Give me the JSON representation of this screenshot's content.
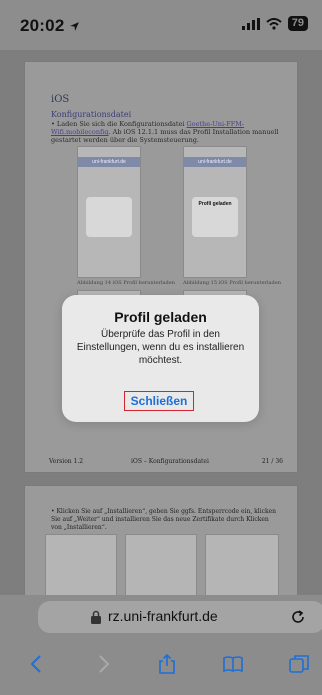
{
  "status": {
    "time": "20:02",
    "battery": "79"
  },
  "document": {
    "section_title": "iOS",
    "sub_title": "Konfigurationsdatei",
    "bullet_intro": "Laden Sie sich die Konfigurationsdatei ",
    "bullet_link": "Goethe-Uni-FFM-Wifi.mobileconfig",
    "bullet_rest": ". Ab iOS 12.1.1 muss das Profil Installation manuell gestartet werden über die Systemsteuerung.",
    "thumb_header": "uni-frankfurt.de",
    "thumb2_dialog_title": "Profil geladen",
    "caption1": "Abbildung 14 iOS Profil herunterladen",
    "caption2": "Abbildung 15 iOS Profil herunterladen",
    "footer_left": "Version 1.2",
    "footer_center": "iOS – Konfigurationsdatei",
    "footer_right": "21 / 36",
    "page2_bullet": "Klicken Sie auf „Installieren“, geben Sie ggfs. Entsperrcode ein, klicken Sie auf „Weiter“ und installieren Sie das neue Zertifikate durch Klicken von „Installieren“."
  },
  "alert": {
    "title": "Profil geladen",
    "message": "Überprüfe das Profil in den Einstellungen, wenn du es installieren möchtest.",
    "button": "Schließen"
  },
  "browser": {
    "url": "rz.uni-frankfurt.de"
  },
  "icons": {
    "back": "chevron-left-icon",
    "forward": "chevron-right-icon",
    "share": "share-icon",
    "bookmarks": "book-icon",
    "tabs": "tabs-icon"
  },
  "colors": {
    "accent": "#1f6fd6",
    "highlight_border": "#d3252f"
  }
}
